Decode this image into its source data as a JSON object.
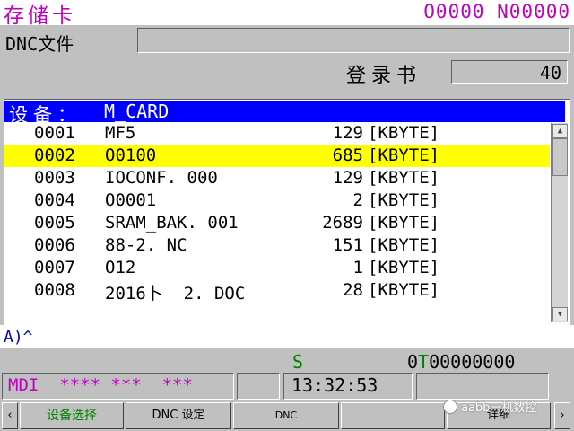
{
  "screen_title": "存储卡",
  "program_number": "O0000 N00000",
  "dnc_file": {
    "label": "DNC文件",
    "value": ""
  },
  "registered": {
    "label": "登录书",
    "value": "40"
  },
  "device": {
    "label": "设备：",
    "value": "M_CARD"
  },
  "files": [
    {
      "no": "0001",
      "name": "MF5",
      "size": "129",
      "unit": "[KBYTE]"
    },
    {
      "no": "0002",
      "name": "O0100",
      "size": "685",
      "unit": "[KBYTE]"
    },
    {
      "no": "0003",
      "name": "IOCONF. 000",
      "size": "129",
      "unit": "[KBYTE]"
    },
    {
      "no": "0004",
      "name": "O0001",
      "size": "2",
      "unit": "[KBYTE]"
    },
    {
      "no": "0005",
      "name": "SRAM_BAK. 001",
      "size": "2689",
      "unit": "[KBYTE]"
    },
    {
      "no": "0006",
      "name": "88-2. NC",
      "size": "151",
      "unit": "[KBYTE]"
    },
    {
      "no": "0007",
      "name": "O12",
      "size": "1",
      "unit": "[KBYTE]"
    },
    {
      "no": "0008",
      "name": "2016卜  2. DOC",
      "size": "28",
      "unit": "[KBYTE]"
    }
  ],
  "selected_index": 1,
  "scrollbar": {
    "up_icon": "triangle-up",
    "down_icon": "triangle-down"
  },
  "input_prompt": "A)^",
  "status": {
    "s_label": "S",
    "t_prefix": "0",
    "t_letter": "T",
    "t_value": "00000000",
    "mode": "MDI  **** ***  ***",
    "time": "13:32:53"
  },
  "softkeys": {
    "left_arrow": "‹",
    "k1": "设备选择",
    "k2": "DNC 设定",
    "k3": "DNC",
    "k4": "",
    "k5": "详细",
    "right_arrow": "›"
  },
  "watermark": "aabb一机数控",
  "colors": {
    "title": "#c000c0",
    "header_bg": "#0000ff",
    "selection": "#ffff00",
    "panel": "#c0c0c0",
    "s_t_green": "#008000"
  }
}
